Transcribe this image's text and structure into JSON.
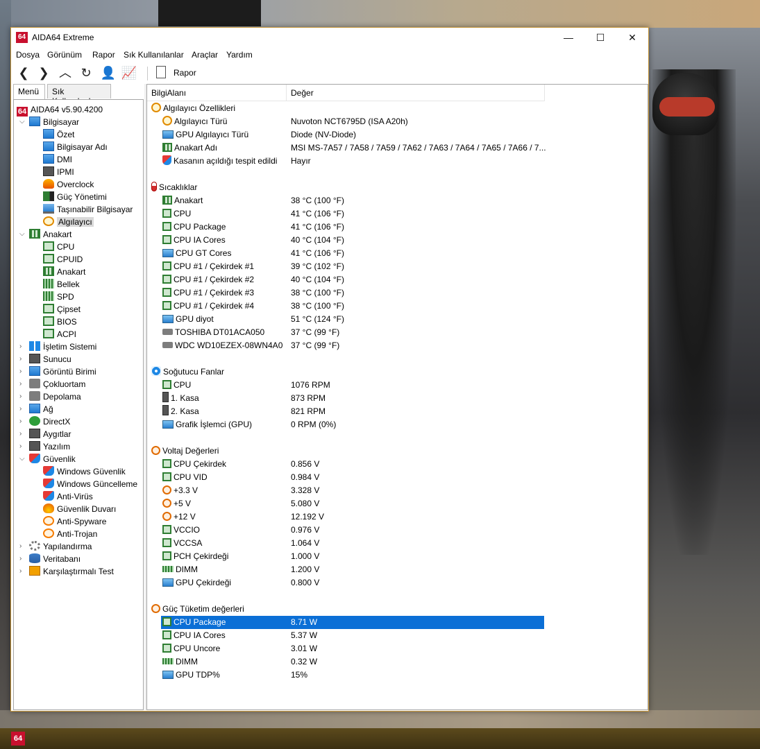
{
  "window": {
    "title": "AIDA64 Extreme",
    "app_icon_text": "64",
    "controls": {
      "minimize": "—",
      "maximize": "☐",
      "close": "✕"
    }
  },
  "menubar": [
    "Dosya",
    "Görünüm",
    "Rapor",
    "Sık Kullanılanlar",
    "Araçlar",
    "Yardım"
  ],
  "toolbar": {
    "report_label": "Rapor",
    "icons": [
      "back-icon",
      "forward-icon",
      "up-icon",
      "refresh-icon",
      "user-icon",
      "chart-icon"
    ]
  },
  "left_tabs": [
    "Menü",
    "Sık Kullanılanlar"
  ],
  "tree": [
    {
      "label": "AIDA64 v5.90.4200",
      "icon": "app",
      "level": 0,
      "exp": ""
    },
    {
      "label": "Bilgisayar",
      "icon": "monitor",
      "level": 1,
      "exp": "⌵"
    },
    {
      "label": "Özet",
      "icon": "monitor",
      "level": 2,
      "exp": ""
    },
    {
      "label": "Bilgisayar Adı",
      "icon": "monitor",
      "level": 2,
      "exp": ""
    },
    {
      "label": "DMI",
      "icon": "monitor",
      "level": 2,
      "exp": ""
    },
    {
      "label": "IPMI",
      "icon": "case",
      "level": 2,
      "exp": ""
    },
    {
      "label": "Overclock",
      "icon": "flame",
      "level": 2,
      "exp": ""
    },
    {
      "label": "Güç Yönetimi",
      "icon": "battery",
      "level": 2,
      "exp": ""
    },
    {
      "label": "Taşınabilir Bilgisayar",
      "icon": "laptop",
      "level": 2,
      "exp": ""
    },
    {
      "label": "Algılayıcı",
      "icon": "gauge",
      "level": 2,
      "exp": "",
      "selected": true
    },
    {
      "label": "Anakart",
      "icon": "mobo",
      "level": 1,
      "exp": "⌵"
    },
    {
      "label": "CPU",
      "icon": "chip",
      "level": 2,
      "exp": ""
    },
    {
      "label": "CPUID",
      "icon": "chip",
      "level": 2,
      "exp": ""
    },
    {
      "label": "Anakart",
      "icon": "mobo",
      "level": 2,
      "exp": ""
    },
    {
      "label": "Bellek",
      "icon": "ram",
      "level": 2,
      "exp": ""
    },
    {
      "label": "SPD",
      "icon": "ram",
      "level": 2,
      "exp": ""
    },
    {
      "label": "Çipset",
      "icon": "chip",
      "level": 2,
      "exp": ""
    },
    {
      "label": "BIOS",
      "icon": "chip",
      "level": 2,
      "exp": ""
    },
    {
      "label": "ACPI",
      "icon": "chip",
      "level": 2,
      "exp": ""
    },
    {
      "label": "İşletim Sistemi",
      "icon": "win",
      "level": 1,
      "exp": "›"
    },
    {
      "label": "Sunucu",
      "icon": "case",
      "level": 1,
      "exp": "›"
    },
    {
      "label": "Görüntü Birimi",
      "icon": "monitor",
      "level": 1,
      "exp": "›"
    },
    {
      "label": "Çokluortam",
      "icon": "hdd",
      "level": 1,
      "exp": "›"
    },
    {
      "label": "Depolama",
      "icon": "hdd",
      "level": 1,
      "exp": "›"
    },
    {
      "label": "Ağ",
      "icon": "monitor",
      "level": 1,
      "exp": "›"
    },
    {
      "label": "DirectX",
      "icon": "xbox",
      "level": 1,
      "exp": "›"
    },
    {
      "label": "Aygıtlar",
      "icon": "case",
      "level": 1,
      "exp": "›"
    },
    {
      "label": "Yazılım",
      "icon": "case",
      "level": 1,
      "exp": "›"
    },
    {
      "label": "Güvenlik",
      "icon": "shield",
      "level": 1,
      "exp": "⌵"
    },
    {
      "label": "Windows Güvenlik",
      "icon": "shield",
      "level": 2,
      "exp": ""
    },
    {
      "label": "Windows Güncelleme",
      "icon": "shield",
      "level": 2,
      "exp": ""
    },
    {
      "label": "Anti-Virüs",
      "icon": "shield",
      "level": 2,
      "exp": ""
    },
    {
      "label": "Güvenlik Duvarı",
      "icon": "fire",
      "level": 2,
      "exp": ""
    },
    {
      "label": "Anti-Spyware",
      "icon": "spy",
      "level": 2,
      "exp": ""
    },
    {
      "label": "Anti-Trojan",
      "icon": "spy",
      "level": 2,
      "exp": ""
    },
    {
      "label": "Yapılandırma",
      "icon": "gear",
      "level": 1,
      "exp": "›"
    },
    {
      "label": "Veritabanı",
      "icon": "db",
      "level": 1,
      "exp": "›"
    },
    {
      "label": "Karşılaştırmalı Test",
      "icon": "bench",
      "level": 1,
      "exp": "›"
    }
  ],
  "columns": [
    "BilgiAlanı",
    "Değer"
  ],
  "sections": [
    {
      "title": "Algılayıcı Özellikleri",
      "icon": "gauge",
      "rows": [
        {
          "field": "Algılayıcı Türü",
          "value": "Nuvoton NCT6795D  (ISA A20h)",
          "icon": "gauge"
        },
        {
          "field": "GPU Algılayıcı Türü",
          "value": "Diode  (NV-Diode)",
          "icon": "gpu"
        },
        {
          "field": "Anakart Adı",
          "value": "MSI MS-7A57 / 7A58 / 7A59 / 7A62 / 7A63 / 7A64 / 7A65 / 7A66 / 7...",
          "icon": "mobo"
        },
        {
          "field": "Kasanın açıldığı tespit edildi",
          "value": "Hayır",
          "icon": "shield"
        }
      ]
    },
    {
      "title": "Sıcaklıklar",
      "icon": "temp",
      "rows": [
        {
          "field": "Anakart",
          "value": "38 °C  (100 °F)",
          "icon": "mobo"
        },
        {
          "field": "CPU",
          "value": "41 °C  (106 °F)",
          "icon": "chip"
        },
        {
          "field": "CPU Package",
          "value": "41 °C  (106 °F)",
          "icon": "chip"
        },
        {
          "field": "CPU IA Cores",
          "value": "40 °C  (104 °F)",
          "icon": "chip"
        },
        {
          "field": "CPU GT Cores",
          "value": "41 °C  (106 °F)",
          "icon": "gpu"
        },
        {
          "field": "CPU #1 / Çekirdek #1",
          "value": "39 °C  (102 °F)",
          "icon": "chip"
        },
        {
          "field": "CPU #1 / Çekirdek #2",
          "value": "40 °C  (104 °F)",
          "icon": "chip"
        },
        {
          "field": "CPU #1 / Çekirdek #3",
          "value": "38 °C  (100 °F)",
          "icon": "chip"
        },
        {
          "field": "CPU #1 / Çekirdek #4",
          "value": "38 °C  (100 °F)",
          "icon": "chip"
        },
        {
          "field": "GPU diyot",
          "value": "51 °C  (124 °F)",
          "icon": "gpu"
        },
        {
          "field": "TOSHIBA DT01ACA050",
          "value": "37 °C  (99 °F)",
          "icon": "hdd"
        },
        {
          "field": "WDC WD10EZEX-08WN4A0",
          "value": "37 °C  (99 °F)",
          "icon": "hdd"
        }
      ]
    },
    {
      "title": "Soğutucu Fanlar",
      "icon": "fan",
      "rows": [
        {
          "field": "CPU",
          "value": "1076 RPM",
          "icon": "chip"
        },
        {
          "field": "1. Kasa",
          "value": "873 RPM",
          "icon": "case"
        },
        {
          "field": "2. Kasa",
          "value": "821 RPM",
          "icon": "case"
        },
        {
          "field": "Grafik İşlemci (GPU)",
          "value": "0 RPM  (0%)",
          "icon": "gpu"
        }
      ]
    },
    {
      "title": "Voltaj Değerleri",
      "icon": "bolt",
      "rows": [
        {
          "field": "CPU Çekirdek",
          "value": "0.856 V",
          "icon": "chip"
        },
        {
          "field": "CPU VID",
          "value": "0.984 V",
          "icon": "chip"
        },
        {
          "field": "+3.3 V",
          "value": "3.328 V",
          "icon": "bolt"
        },
        {
          "field": "+5 V",
          "value": "5.080 V",
          "icon": "bolt"
        },
        {
          "field": "+12 V",
          "value": "12.192 V",
          "icon": "bolt"
        },
        {
          "field": "VCCIO",
          "value": "0.976 V",
          "icon": "chip"
        },
        {
          "field": "VCCSA",
          "value": "1.064 V",
          "icon": "chip"
        },
        {
          "field": "PCH Çekirdeği",
          "value": "1.000 V",
          "icon": "chip"
        },
        {
          "field": "DIMM",
          "value": "1.200 V",
          "icon": "ram"
        },
        {
          "field": "GPU Çekirdeği",
          "value": "0.800 V",
          "icon": "gpu"
        }
      ]
    },
    {
      "title": "Güç Tüketim değerleri",
      "icon": "bolt",
      "rows": [
        {
          "field": "CPU Package",
          "value": "8.71 W",
          "icon": "chip",
          "selected": true
        },
        {
          "field": "CPU IA Cores",
          "value": "5.37 W",
          "icon": "chip"
        },
        {
          "field": "CPU Uncore",
          "value": "3.01 W",
          "icon": "chip"
        },
        {
          "field": "DIMM",
          "value": "0.32 W",
          "icon": "ram"
        },
        {
          "field": "GPU TDP%",
          "value": "15%",
          "icon": "gpu"
        }
      ]
    }
  ],
  "taskbar": {
    "app_icon_text": "64"
  }
}
